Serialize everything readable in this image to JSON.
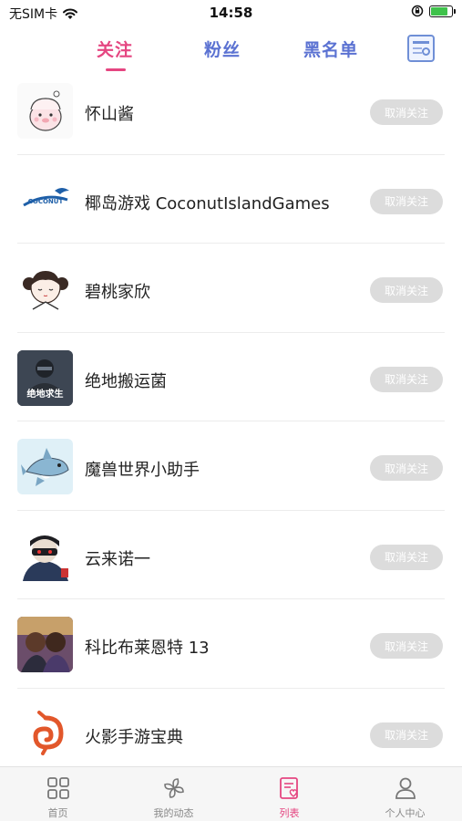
{
  "status_bar": {
    "carrier": "无SIM卡",
    "time": "14:58",
    "battery_level": 0.8
  },
  "tabs": {
    "follow": "关注",
    "fans": "粉丝",
    "blacklist": "黑名单",
    "active": "follow"
  },
  "header_action_icon": "profile-card-search-icon",
  "following": [
    {
      "name": "怀山酱",
      "button": "取消关注",
      "avatar": "cartoon-pig-avatar"
    },
    {
      "name": "椰岛游戏 CoconutIslandGames",
      "button": "取消关注",
      "avatar": "coconut-island-logo-avatar"
    },
    {
      "name": "碧桃家欣",
      "button": "取消关注",
      "avatar": "cartoon-girl-avatar"
    },
    {
      "name": "绝地搬运菌",
      "button": "取消关注",
      "avatar": "pubg-avatar"
    },
    {
      "name": "魔兽世界小助手",
      "button": "取消关注",
      "avatar": "cartoon-shark-avatar"
    },
    {
      "name": "云来诺一",
      "button": "取消关注",
      "avatar": "masked-character-avatar"
    },
    {
      "name": "科比布莱恩特 13",
      "button": "取消关注",
      "avatar": "photo-avatar"
    },
    {
      "name": "火影手游宝典",
      "button": "取消关注",
      "avatar": "leaf-spiral-logo-avatar"
    }
  ],
  "avatar_labels": {
    "pubg": "绝地求生",
    "coconut": "COCONUT"
  },
  "bottom_nav": [
    {
      "label": "首页",
      "icon": "home-grid-icon"
    },
    {
      "label": "我的动态",
      "icon": "pinwheel-icon"
    },
    {
      "label": "列表",
      "icon": "list-heart-icon",
      "active": true
    },
    {
      "label": "个人中心",
      "icon": "user-icon"
    }
  ],
  "colors": {
    "accent_pink": "#e54681",
    "tab_blue": "#5b72d2",
    "button_gray": "#dcdcdc"
  }
}
